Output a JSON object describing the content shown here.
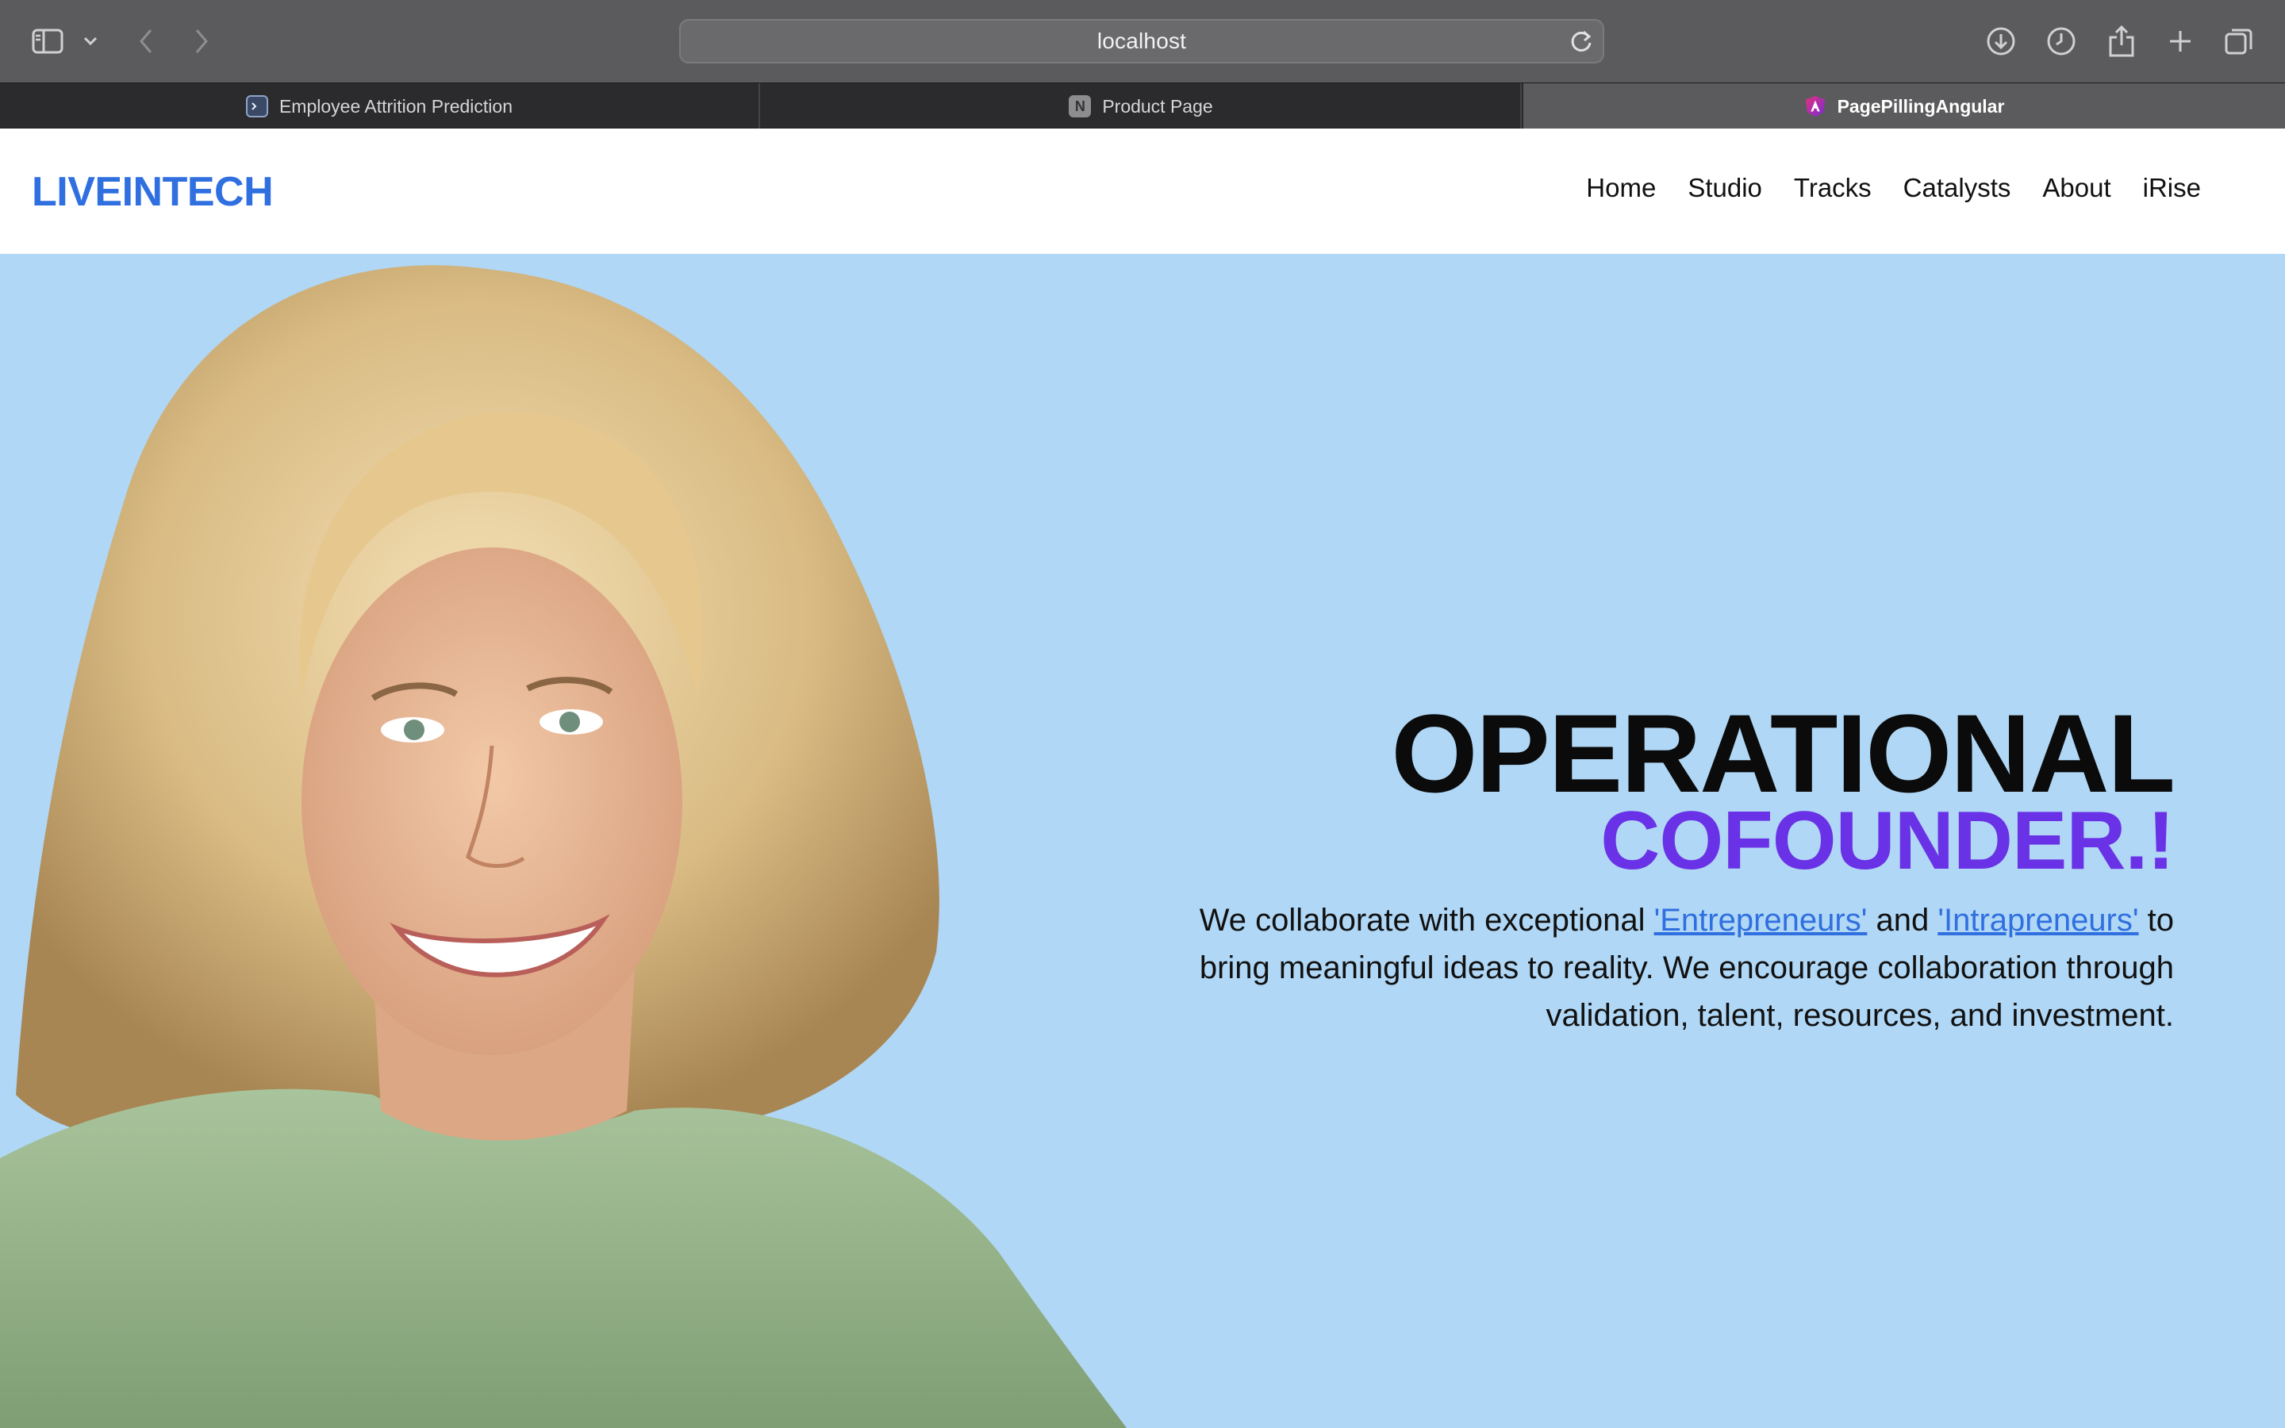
{
  "browser": {
    "url": "localhost",
    "tabs": [
      {
        "label": "Employee Attrition Prediction",
        "active": false
      },
      {
        "label": "Product Page",
        "active": false,
        "favicon_letter": "N"
      },
      {
        "label": "PagePillingAngular",
        "active": true
      }
    ]
  },
  "site": {
    "logo": "LIVEINTECH",
    "nav": [
      "Home",
      "Studio",
      "Tracks",
      "Catalysts",
      "About",
      "iRise"
    ],
    "hero": {
      "title_line1": "OPERATIONAL",
      "title_line2": "COFOUNDER.!",
      "desc_part1": "We collaborate with exceptional ",
      "link1": "'Entrepreneurs'",
      "desc_part2": " and ",
      "link2": "'Intrapreneurs'",
      "desc_part3": " to bring meaningful ideas to reality. We encourage collaboration through validation, talent, resources, and investment."
    }
  },
  "colors": {
    "brand": "#2f6fe0",
    "accent_purple": "#6a32e6",
    "hero_background": "#b0d7f5"
  }
}
